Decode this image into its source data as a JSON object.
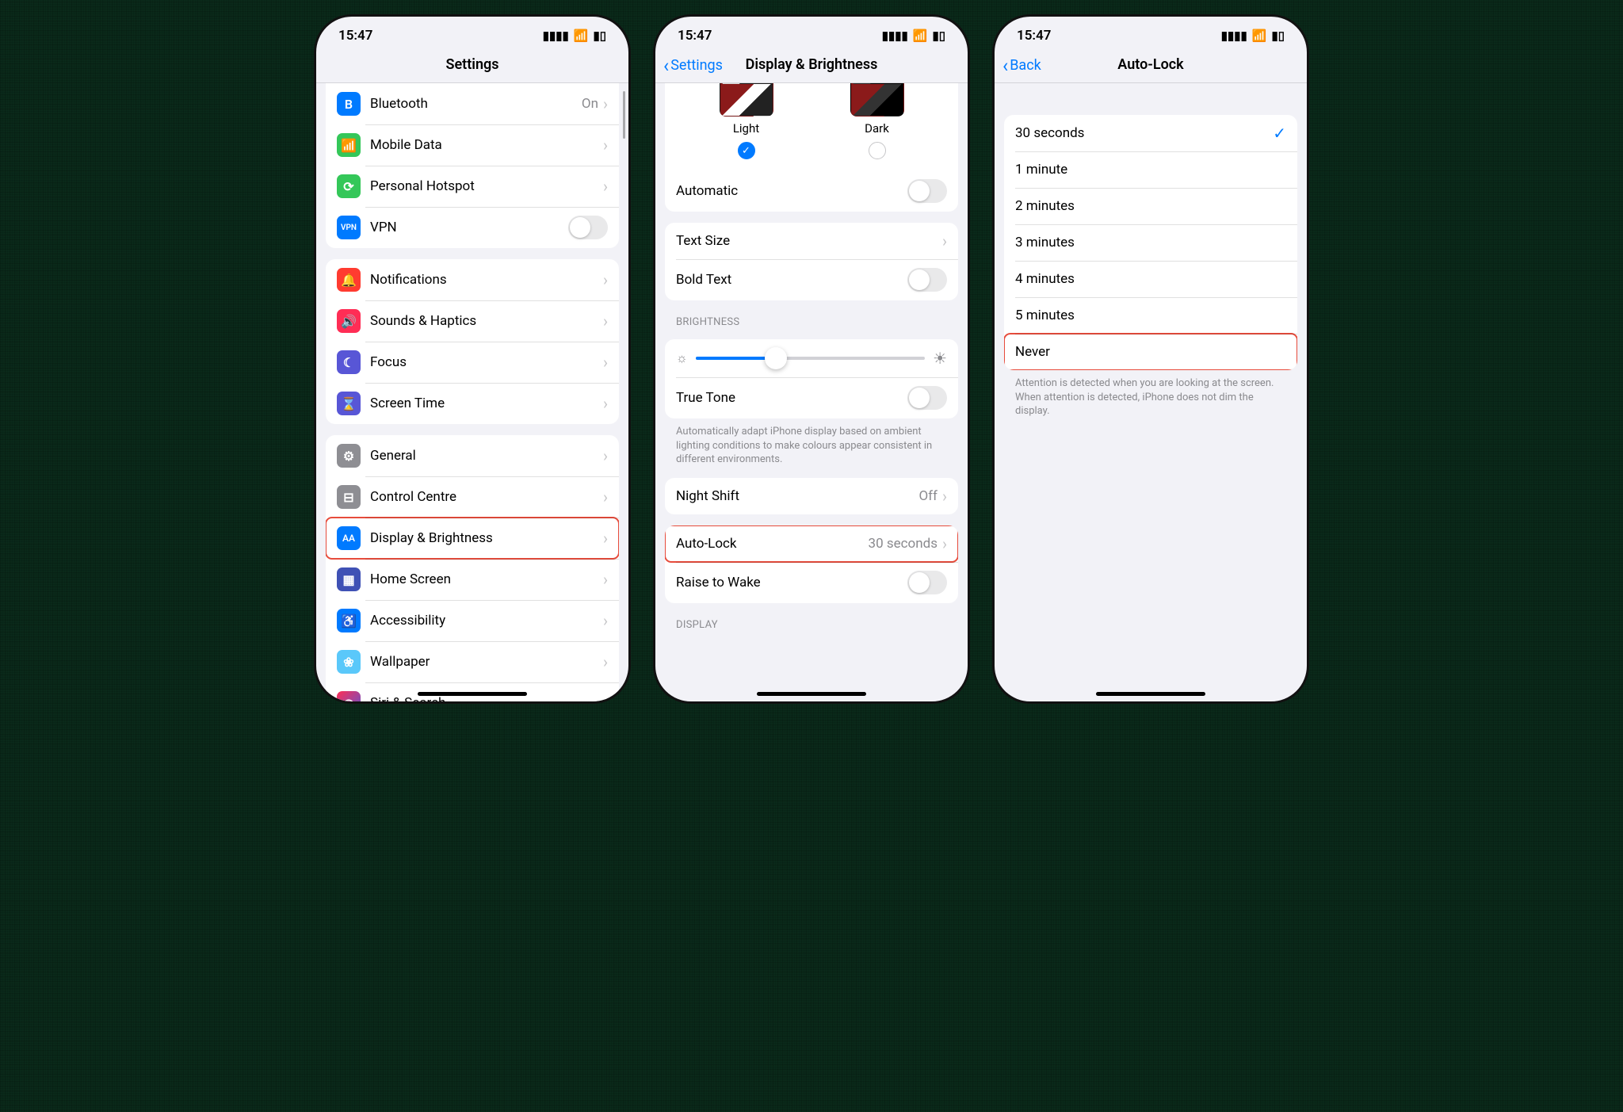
{
  "status": {
    "time": "15:47"
  },
  "screen1": {
    "title": "Settings",
    "g1": [
      {
        "label": "Bluetooth",
        "value": "On",
        "iconColor": "#007aff",
        "glyph": "B"
      },
      {
        "label": "Mobile Data",
        "value": "",
        "iconColor": "#34c759",
        "glyph": "📶"
      },
      {
        "label": "Personal Hotspot",
        "value": "",
        "iconColor": "#34c759",
        "glyph": "⟳"
      },
      {
        "label": "VPN",
        "value": "",
        "iconColor": "#007aff",
        "glyph": "VPN"
      }
    ],
    "g2": [
      {
        "label": "Notifications",
        "iconColor": "#ff3b30",
        "glyph": "🔔"
      },
      {
        "label": "Sounds & Haptics",
        "iconColor": "#ff2d55",
        "glyph": "🔊"
      },
      {
        "label": "Focus",
        "iconColor": "#5856d6",
        "glyph": "☾"
      },
      {
        "label": "Screen Time",
        "iconColor": "#5856d6",
        "glyph": "⌛"
      }
    ],
    "g3": [
      {
        "label": "General",
        "iconColor": "#8e8e93",
        "glyph": "⚙"
      },
      {
        "label": "Control Centre",
        "iconColor": "#8e8e93",
        "glyph": "⊟"
      },
      {
        "label": "Display & Brightness",
        "iconColor": "#007aff",
        "glyph": "AA"
      },
      {
        "label": "Home Screen",
        "iconColor": "#3f51b5",
        "glyph": "▦"
      },
      {
        "label": "Accessibility",
        "iconColor": "#007aff",
        "glyph": "♿"
      },
      {
        "label": "Wallpaper",
        "iconColor": "#5ac8fa",
        "glyph": "❀"
      },
      {
        "label": "Siri & Search",
        "iconColor": "#222",
        "glyph": "◉"
      }
    ]
  },
  "screen2": {
    "back": "Settings",
    "title": "Display & Brightness",
    "lightLabel": "Light",
    "darkLabel": "Dark",
    "automatic": "Automatic",
    "textSize": "Text Size",
    "boldText": "Bold Text",
    "brightnessHeader": "BRIGHTNESS",
    "trueTone": "True Tone",
    "trueToneFooter": "Automatically adapt iPhone display based on ambient lighting conditions to make colours appear consistent in different environments.",
    "nightShift": {
      "label": "Night Shift",
      "value": "Off"
    },
    "autoLock": {
      "label": "Auto-Lock",
      "value": "30 seconds"
    },
    "raiseToWake": "Raise to Wake",
    "displayHeader": "DISPLAY"
  },
  "screen3": {
    "back": "Back",
    "title": "Auto-Lock",
    "options": [
      "30 seconds",
      "1 minute",
      "2 minutes",
      "3 minutes",
      "4 minutes",
      "5 minutes",
      "Never"
    ],
    "selected": "30 seconds",
    "footer": "Attention is detected when you are looking at the screen. When attention is detected, iPhone does not dim the display."
  }
}
